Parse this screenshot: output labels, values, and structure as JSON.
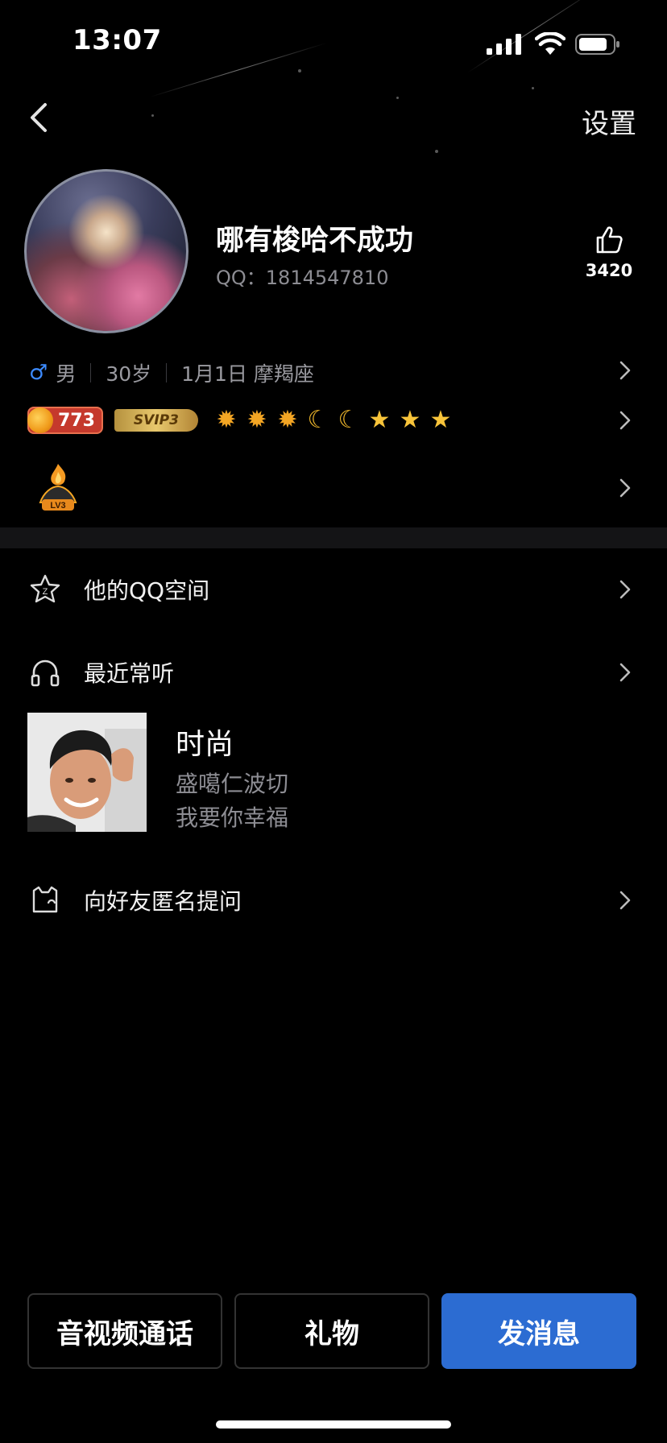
{
  "status_bar": {
    "time": "13:07"
  },
  "nav": {
    "settings_label": "设置"
  },
  "profile": {
    "nickname": "哪有梭哈不成功",
    "qq": "QQ：1814547810",
    "likes": "3420",
    "gender_symbol": "♂",
    "gender": "男",
    "age": "30岁",
    "birthday": "1月1日 摩羯座",
    "coin_level": "773",
    "svip": "SVIP3",
    "level_badge": "LV3"
  },
  "menu": {
    "qzone": "他的QQ空间",
    "recent_music": "最近常听",
    "anonymous_question": "向好友匿名提问"
  },
  "music": {
    "title": "时尚",
    "artist": "盛噶仁波切",
    "song": "我要你幸福"
  },
  "actions": {
    "call": "音视频通话",
    "gift": "礼物",
    "message": "发消息"
  },
  "colors": {
    "primary_button": "#2c6cd2",
    "male_symbol": "#3d8bff"
  }
}
